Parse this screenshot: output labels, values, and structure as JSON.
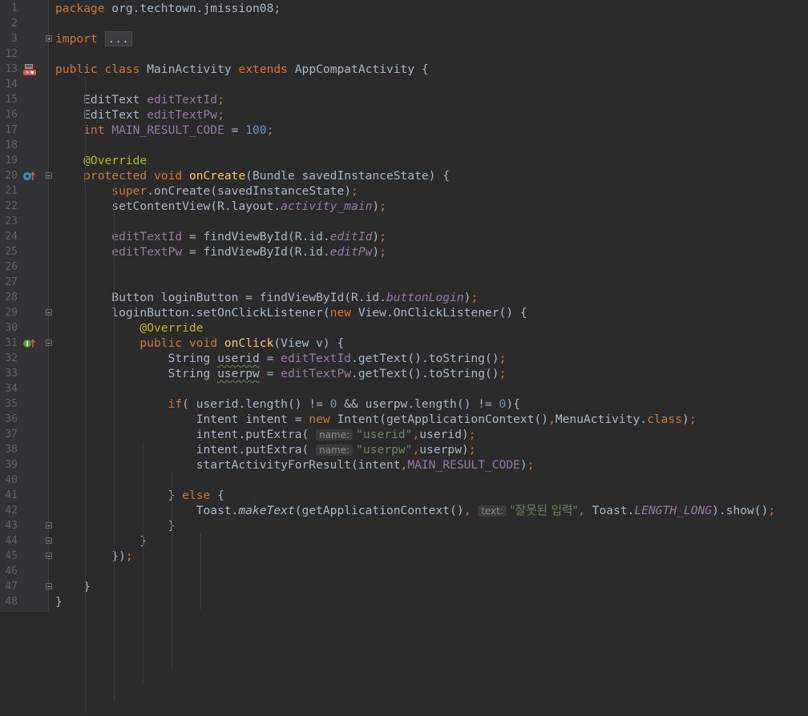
{
  "lines": [
    {
      "n": "1",
      "segs": [
        {
          "c": "kw",
          "t": "package "
        },
        {
          "c": "",
          "t": "org.techtown.jmission08;"
        }
      ]
    },
    {
      "n": "2",
      "segs": []
    },
    {
      "n": "3",
      "segs": [
        {
          "c": "kw",
          "t": "import "
        },
        {
          "c": "fold-txt",
          "t": "..."
        }
      ],
      "fold": "plus"
    },
    {
      "n": "12",
      "segs": []
    },
    {
      "n": "13",
      "segs": [
        {
          "c": "kw",
          "t": "public class "
        },
        {
          "c": "",
          "t": "MainActivity "
        },
        {
          "c": "kw",
          "t": "extends "
        },
        {
          "c": "",
          "t": "AppCompatActivity {"
        }
      ],
      "marker": "run"
    },
    {
      "n": "14",
      "segs": []
    },
    {
      "n": "15",
      "segs": [
        {
          "c": "",
          "t": "    EditText "
        },
        {
          "c": "field",
          "t": "editTextId"
        },
        {
          "c": "kw",
          "t": ";"
        }
      ]
    },
    {
      "n": "16",
      "segs": [
        {
          "c": "",
          "t": "    EditText "
        },
        {
          "c": "field",
          "t": "editTextPw"
        },
        {
          "c": "kw",
          "t": ";"
        }
      ]
    },
    {
      "n": "17",
      "segs": [
        {
          "c": "kw",
          "t": "    int "
        },
        {
          "c": "field",
          "t": "MAIN_RESULT_CODE "
        },
        {
          "c": "",
          "t": "= "
        },
        {
          "c": "num",
          "t": "100"
        },
        {
          "c": "kw",
          "t": ";"
        }
      ]
    },
    {
      "n": "18",
      "segs": []
    },
    {
      "n": "19",
      "segs": [
        {
          "c": "ann",
          "t": "    @Override"
        }
      ]
    },
    {
      "n": "20",
      "segs": [
        {
          "c": "kw",
          "t": "    protected void "
        },
        {
          "c": "fn",
          "t": "onCreate"
        },
        {
          "c": "",
          "t": "(Bundle savedInstanceState) {"
        }
      ],
      "marker": "override",
      "fold": "minus"
    },
    {
      "n": "21",
      "segs": [
        {
          "c": "kw",
          "t": "        super"
        },
        {
          "c": "",
          "t": ".onCreate(savedInstanceState)"
        },
        {
          "c": "kw",
          "t": ";"
        }
      ]
    },
    {
      "n": "22",
      "segs": [
        {
          "c": "",
          "t": "        setContentView(R.layout."
        },
        {
          "c": "ifield",
          "t": "activity_main"
        },
        {
          "c": "",
          "t": ")"
        },
        {
          "c": "kw",
          "t": ";"
        }
      ]
    },
    {
      "n": "23",
      "segs": []
    },
    {
      "n": "24",
      "segs": [
        {
          "c": "field",
          "t": "        editTextId "
        },
        {
          "c": "",
          "t": "= findViewById(R.id."
        },
        {
          "c": "ifield",
          "t": "editId"
        },
        {
          "c": "",
          "t": ")"
        },
        {
          "c": "kw",
          "t": ";"
        }
      ]
    },
    {
      "n": "25",
      "segs": [
        {
          "c": "field",
          "t": "        editTextPw "
        },
        {
          "c": "",
          "t": "= findViewById(R.id."
        },
        {
          "c": "ifield",
          "t": "editPw"
        },
        {
          "c": "",
          "t": ")"
        },
        {
          "c": "kw",
          "t": ";"
        }
      ]
    },
    {
      "n": "26",
      "segs": []
    },
    {
      "n": "27",
      "segs": []
    },
    {
      "n": "28",
      "segs": [
        {
          "c": "",
          "t": "        Button loginButton = findViewById(R.id."
        },
        {
          "c": "ifield",
          "t": "buttonLogin"
        },
        {
          "c": "",
          "t": ")"
        },
        {
          "c": "kw",
          "t": ";"
        }
      ]
    },
    {
      "n": "29",
      "segs": [
        {
          "c": "",
          "t": "        loginButton.setOnClickListener("
        },
        {
          "c": "kw",
          "t": "new "
        },
        {
          "c": "",
          "t": "View.OnClickListener() {"
        }
      ],
      "fold": "minus"
    },
    {
      "n": "30",
      "segs": [
        {
          "c": "ann",
          "t": "            @Override"
        }
      ]
    },
    {
      "n": "31",
      "segs": [
        {
          "c": "kw",
          "t": "            public void "
        },
        {
          "c": "fn",
          "t": "onClick"
        },
        {
          "c": "",
          "t": "(View v) {"
        }
      ],
      "marker": "implement",
      "fold": "minus"
    },
    {
      "n": "32",
      "segs": [
        {
          "c": "",
          "t": "                String "
        },
        {
          "c": "warn",
          "t": "userid"
        },
        {
          "c": "",
          "t": " = "
        },
        {
          "c": "field",
          "t": "editTextId"
        },
        {
          "c": "",
          "t": ".getText().toString()"
        },
        {
          "c": "kw",
          "t": ";"
        }
      ]
    },
    {
      "n": "33",
      "segs": [
        {
          "c": "",
          "t": "                String "
        },
        {
          "c": "warn",
          "t": "userpw"
        },
        {
          "c": "",
          "t": " = "
        },
        {
          "c": "field",
          "t": "editTextPw"
        },
        {
          "c": "",
          "t": ".getText().toString()"
        },
        {
          "c": "kw",
          "t": ";"
        }
      ]
    },
    {
      "n": "34",
      "segs": []
    },
    {
      "n": "35",
      "segs": [
        {
          "c": "kw",
          "t": "                if"
        },
        {
          "c": "",
          "t": "( userid.length() != "
        },
        {
          "c": "num",
          "t": "0 "
        },
        {
          "c": "",
          "t": "&& userpw.length() != "
        },
        {
          "c": "num",
          "t": "0"
        },
        {
          "c": "",
          "t": "){"
        }
      ]
    },
    {
      "n": "36",
      "segs": [
        {
          "c": "",
          "t": "                    Intent intent = "
        },
        {
          "c": "kw",
          "t": "new "
        },
        {
          "c": "",
          "t": "Intent(getApplicationContext()"
        },
        {
          "c": "kw",
          "t": ","
        },
        {
          "c": "",
          "t": "MenuActivity."
        },
        {
          "c": "kw",
          "t": "class"
        },
        {
          "c": "",
          "t": ")"
        },
        {
          "c": "kw",
          "t": ";"
        }
      ]
    },
    {
      "n": "37",
      "segs": [
        {
          "c": "",
          "t": "                    intent.putExtra( "
        },
        {
          "c": "hint",
          "t": "name:"
        },
        {
          "c": "str",
          "t": "\"userid\""
        },
        {
          "c": "kw",
          "t": ","
        },
        {
          "c": "",
          "t": "userid)"
        },
        {
          "c": "kw",
          "t": ";"
        }
      ]
    },
    {
      "n": "38",
      "segs": [
        {
          "c": "",
          "t": "                    intent.putExtra( "
        },
        {
          "c": "hint",
          "t": "name:"
        },
        {
          "c": "str",
          "t": "\"userpw\""
        },
        {
          "c": "kw",
          "t": ","
        },
        {
          "c": "",
          "t": "userpw)"
        },
        {
          "c": "kw",
          "t": ";"
        }
      ]
    },
    {
      "n": "39",
      "segs": [
        {
          "c": "",
          "t": "                    startActivityForResult(intent"
        },
        {
          "c": "kw",
          "t": ","
        },
        {
          "c": "field",
          "t": "MAIN_RESULT_CODE"
        },
        {
          "c": "",
          "t": ")"
        },
        {
          "c": "kw",
          "t": ";"
        }
      ]
    },
    {
      "n": "40",
      "segs": []
    },
    {
      "n": "41",
      "segs": [
        {
          "c": "",
          "t": "                } "
        },
        {
          "c": "kw",
          "t": "else "
        },
        {
          "c": "",
          "t": "{"
        }
      ]
    },
    {
      "n": "42",
      "segs": [
        {
          "c": "",
          "t": "                    Toast."
        },
        {
          "c": "sfn",
          "t": "makeText"
        },
        {
          "c": "",
          "t": "(getApplicationContext()"
        },
        {
          "c": "kw",
          "t": ", "
        },
        {
          "c": "hint",
          "t": "text:"
        },
        {
          "c": "str kor",
          "t": "\"잘못된 입력\""
        },
        {
          "c": "kw",
          "t": ", "
        },
        {
          "c": "",
          "t": "Toast."
        },
        {
          "c": "ifield",
          "t": "LENGTH_LONG"
        },
        {
          "c": "",
          "t": ").show()"
        },
        {
          "c": "kw",
          "t": ";"
        }
      ]
    },
    {
      "n": "43",
      "segs": [
        {
          "c": "",
          "t": "                }"
        }
      ],
      "fold": "minus"
    },
    {
      "n": "44",
      "segs": [
        {
          "c": "",
          "t": "            }"
        }
      ],
      "fold": "minus"
    },
    {
      "n": "45",
      "segs": [
        {
          "c": "",
          "t": "        })"
        },
        {
          "c": "kw",
          "t": ";"
        }
      ],
      "fold": "minus"
    },
    {
      "n": "46",
      "segs": []
    },
    {
      "n": "47",
      "segs": [
        {
          "c": "",
          "t": "    }"
        }
      ],
      "fold": "minus"
    },
    {
      "n": "48",
      "segs": [
        {
          "c": "",
          "t": "}"
        }
      ]
    }
  ],
  "icons": {
    "run": "run-gutter-icon",
    "override": "override-method-icon",
    "implement": "implement-method-icon"
  },
  "colors": {
    "background": "#2b2b2b",
    "keyword": "#cc7832",
    "annotation": "#bbb529",
    "field": "#9876aa",
    "number": "#6897bb",
    "string": "#6a8759",
    "method": "#ffc66d"
  }
}
